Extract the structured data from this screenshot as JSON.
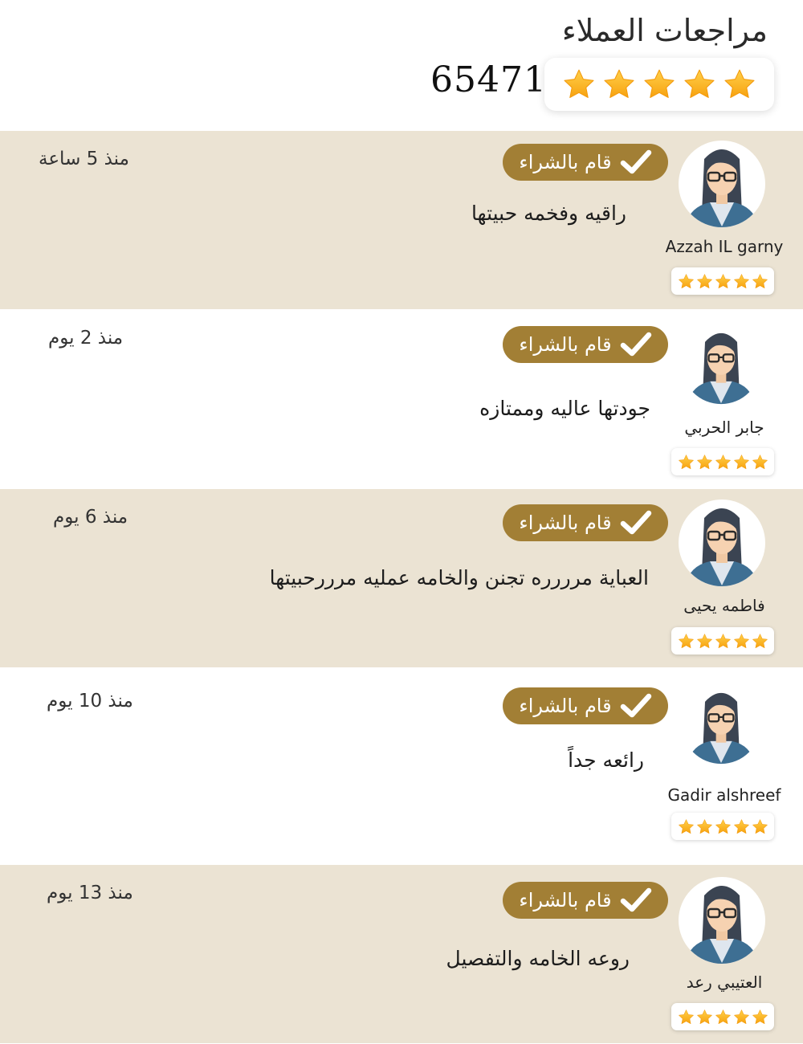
{
  "header": {
    "title": "مراجعات العملاء",
    "average_stars": 5,
    "total_reviews": "65471"
  },
  "colors": {
    "accent_gold": "#a27f35",
    "row_shade": "#ebe3d3",
    "star": "#fbb51c"
  },
  "icons": {
    "badge_icon": "check-icon",
    "star_icon": "star-icon",
    "avatar_icon": "user-avatar-icon"
  },
  "reviews": [
    {
      "name": "Azzah IL garny",
      "time": "منذ 5 ساعة",
      "badge": "قام بالشراء",
      "comment": "راقيه وفخمه حبيتها",
      "stars": 5
    },
    {
      "name": "جابر الحربي",
      "time": "منذ 2 يوم",
      "badge": "قام بالشراء",
      "comment": "جودتها عاليه وممتازه",
      "stars": 5
    },
    {
      "name": "فاطمه يحيى",
      "time": "منذ 6 يوم",
      "badge": "قام بالشراء",
      "comment": "العباية مرررره تجنن والخامه عمليه مرررحبيتها",
      "stars": 5
    },
    {
      "name": "Gadir alshreef",
      "time": "منذ 10 يوم",
      "badge": "قام بالشراء",
      "comment": "رائعه جداً",
      "stars": 5
    },
    {
      "name": "العتيبي رعد",
      "time": "منذ 13 يوم",
      "badge": "قام بالشراء",
      "comment": "روعه الخامه والتفصيل",
      "stars": 5
    }
  ]
}
